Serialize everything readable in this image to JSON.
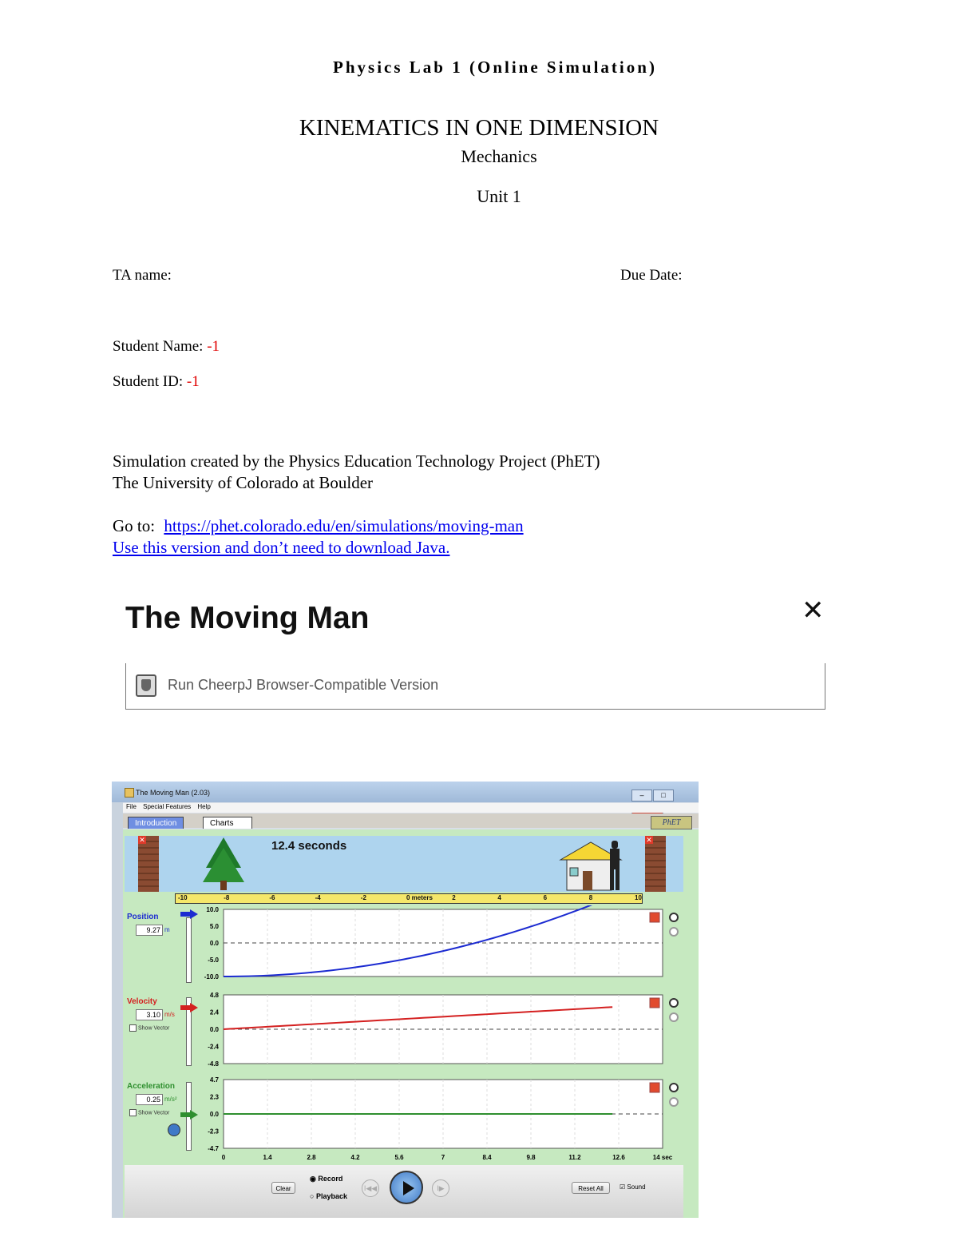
{
  "header": {
    "lab_title": "Physics Lab 1 (Online Simulation)",
    "main_title": "KINEMATICS IN ONE DIMENSION",
    "subtitle": "Mechanics",
    "unit": "Unit 1"
  },
  "fields": {
    "ta_label": "TA name:",
    "due_label": "Due Date:",
    "student_name_label": "Student Name:",
    "student_name_value": "-1",
    "student_id_label": "Student ID:",
    "student_id_value": "-1"
  },
  "credits": {
    "line1": "Simulation created by the Physics Education Technology Project (PhET)",
    "line2": "The University of Colorado at Boulder"
  },
  "links": {
    "goto_label": "Go to:",
    "sim_url": "https://phet.colorado.edu/en/simulations/moving-man",
    "version_link": "Use this version and don’t need to download Java."
  },
  "moving_man_panel": {
    "title": "The Moving Man",
    "close_icon": "close-icon",
    "run_label": "Run CheerpJ Browser-Compatible Version"
  },
  "simulator": {
    "window_title": "The Moving Man (2.03)",
    "menu": [
      "File",
      "Special Features",
      "Help"
    ],
    "tabs": [
      "Introduction",
      "Charts"
    ],
    "logo": "PhET",
    "time_readout": "12.4 seconds",
    "ruler_labels": [
      "-10",
      "-8",
      "-6",
      "-4",
      "-2",
      "0 meters",
      "2",
      "4",
      "6",
      "8",
      "10"
    ],
    "position": {
      "label": "Position",
      "value": "9.27",
      "unit": "m",
      "ticks": [
        "10.0",
        "5.0",
        "0.0",
        "-5.0",
        "-10.0"
      ]
    },
    "velocity": {
      "label": "Velocity",
      "value": "3.10",
      "unit": "m/s",
      "show_vector": "Show Vector",
      "ticks": [
        "4.8",
        "2.4",
        "0.0",
        "-2.4",
        "-4.8"
      ]
    },
    "acceleration": {
      "label": "Acceleration",
      "value": "0.25",
      "unit": "m/s²",
      "show_vector": "Show Vector",
      "ticks": [
        "4.7",
        "2.3",
        "0.0",
        "-2.3",
        "-4.7"
      ]
    },
    "time_ticks": [
      "0",
      "1.4",
      "2.8",
      "4.2",
      "5.6",
      "7",
      "8.4",
      "9.8",
      "11.2",
      "12.6",
      "14 sec"
    ],
    "controls": {
      "clear": "Clear",
      "record": "Record",
      "playback": "Playback",
      "reset_all": "Reset All",
      "sound": "Sound"
    },
    "colors": {
      "position": "#1c2bd1",
      "velocity": "#d42020",
      "acceleration": "#2f8f2f"
    }
  }
}
